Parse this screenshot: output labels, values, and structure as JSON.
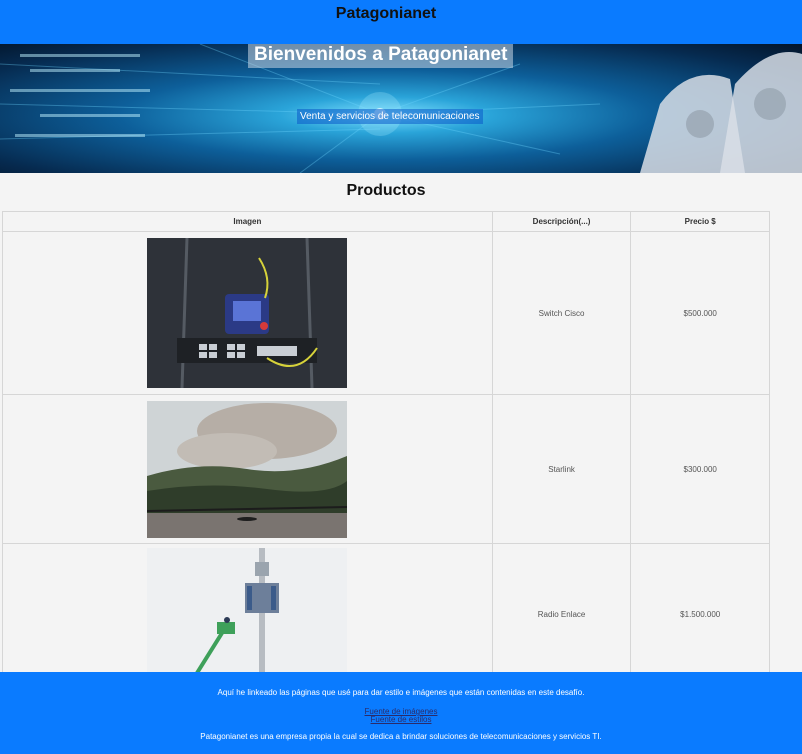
{
  "header": {
    "title": "Patagonianet"
  },
  "hero": {
    "title": "Bienvenidos a Patagonianet",
    "subtitle": "Venta y servicios de telecomunicaciones"
  },
  "products": {
    "title": "Productos",
    "columns": [
      "Imagen",
      "Descripción(...)",
      "Precio $"
    ],
    "rows": [
      {
        "image_icon": "network-switch-photo",
        "description": "Switch Cisco",
        "price": "$500.000"
      },
      {
        "image_icon": "forest-landscape-photo",
        "description": "Starlink",
        "price": "$300.000"
      },
      {
        "image_icon": "antenna-tower-photo",
        "description": "Radio Enlace",
        "price": "$1.500.000"
      }
    ]
  },
  "footer": {
    "note": "Aquí he linkeado las páginas que usé para dar estilo e imágenes que están contenidas en este desafío.",
    "links": [
      "Fuente de imágenes",
      "Fuente de estilos"
    ],
    "about": "Patagonianet es una empresa propia la cual se dedica a brindar soluciones de telecomunicaciones y servicios TI."
  },
  "colors": {
    "header_bg": "#0a7bff",
    "footer_bg": "#0a7bff",
    "page_bg": "#f4f4f4"
  }
}
